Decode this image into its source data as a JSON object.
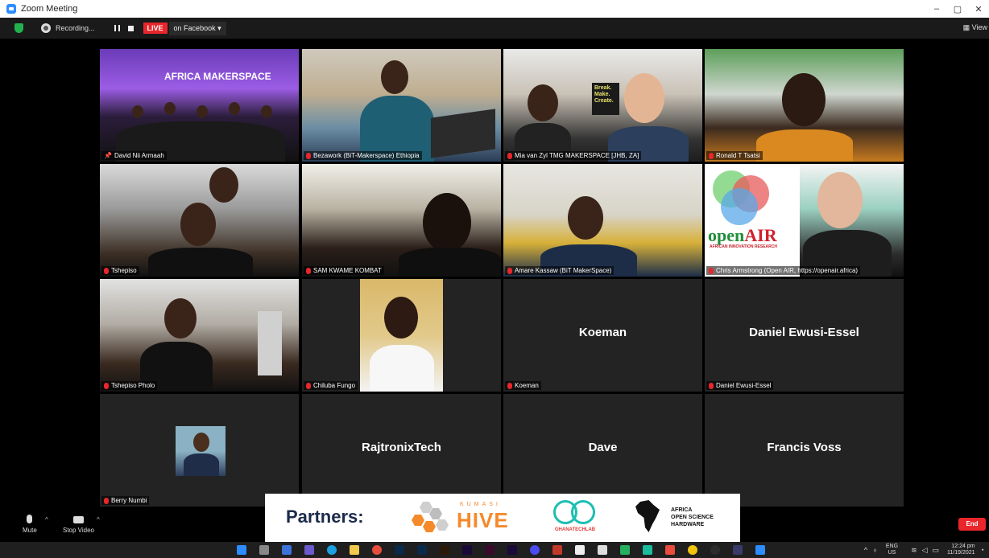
{
  "window": {
    "title": "Zoom Meeting",
    "minimize": "–",
    "maximize": "▢",
    "close": "✕"
  },
  "topbar": {
    "recording_label": "Recording...",
    "live_label": "LIVE",
    "facebook_label": "on Facebook ▾",
    "view_label": "View"
  },
  "participants": [
    {
      "name": "David Nii Armaah",
      "muted": false,
      "video": true,
      "active": true
    },
    {
      "name": "Bezawork (BiT-Makerspace) Ethiopia",
      "muted": true,
      "video": true
    },
    {
      "name": "Mia van Zyl TMG MAKERSPACE [JHB, ZA]",
      "muted": true,
      "video": true
    },
    {
      "name": "Ronald T Tsatsi",
      "muted": true,
      "video": true
    },
    {
      "name": "Tshepiso",
      "muted": true,
      "video": true
    },
    {
      "name": "SAM KWAME KOMBAT",
      "muted": true,
      "video": true
    },
    {
      "name": "Amare Kassaw (BiT MakerSpace)",
      "muted": true,
      "video": true
    },
    {
      "name": "Chris Armstrong (Open AIR, https://openair.africa)",
      "muted": true,
      "video": true
    },
    {
      "name": "Tshepiso Pholo",
      "muted": true,
      "video": true
    },
    {
      "name": "Chiluba Fungo",
      "muted": true,
      "video": true
    },
    {
      "name": "Koeman",
      "muted": true,
      "video": false
    },
    {
      "name": "Daniel Ewusi-Essel",
      "muted": true,
      "video": false
    },
    {
      "name": "Berry Numbi",
      "muted": true,
      "video": false
    },
    {
      "name": "RajtronixTech",
      "muted": true,
      "video": false
    },
    {
      "name": "Dave",
      "muted": true,
      "video": false
    },
    {
      "name": "Francis Voss",
      "muted": true,
      "video": false
    }
  ],
  "scene_text": {
    "makerspace_banner": "AFRICA MAKERSPACE",
    "break_sign": "Break. Make. Create.",
    "openair_open": "open",
    "openair_air": "AIR",
    "openair_sub": "AFRICAN INNOVATION RESEARCH"
  },
  "partners": {
    "label": "Partners:",
    "hive_top": "KUMASI",
    "hive_main": "HIVE",
    "gtl": "GHANATECHLAB",
    "aosh_line1": "AFRICA",
    "aosh_line2": "OPEN SCIENCE",
    "aosh_line3": "HARDWARE"
  },
  "controls": {
    "mute_label": "Mute",
    "video_label": "Stop Video",
    "end_label": "End"
  },
  "taskbar": {
    "lang_top": "ENG",
    "lang_bottom": "US",
    "time": "12:24 pm",
    "date": "11/19/2021"
  },
  "colors": {
    "accent_blue": "#2d8cff",
    "live_red": "#e8262b",
    "active_speaker": "#f5e34b",
    "tile_bg": "#232323"
  }
}
